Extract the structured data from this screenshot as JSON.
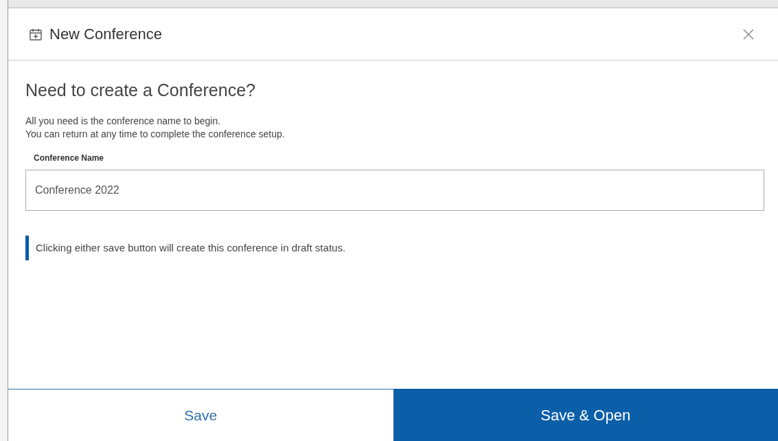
{
  "dialog": {
    "title": "New Conference",
    "heading": "Need to create a Conference?",
    "intro": [
      "All you need is the conference name to begin.",
      "You can return at any time to complete the conference setup."
    ],
    "field": {
      "label": "Conference Name",
      "value": "Conference 2022"
    },
    "note": "Clicking either save button will create this conference in draft status.",
    "buttons": [
      {
        "label": "Save",
        "kind": "secondary"
      },
      {
        "label": "Save & Open",
        "kind": "primary"
      }
    ]
  }
}
